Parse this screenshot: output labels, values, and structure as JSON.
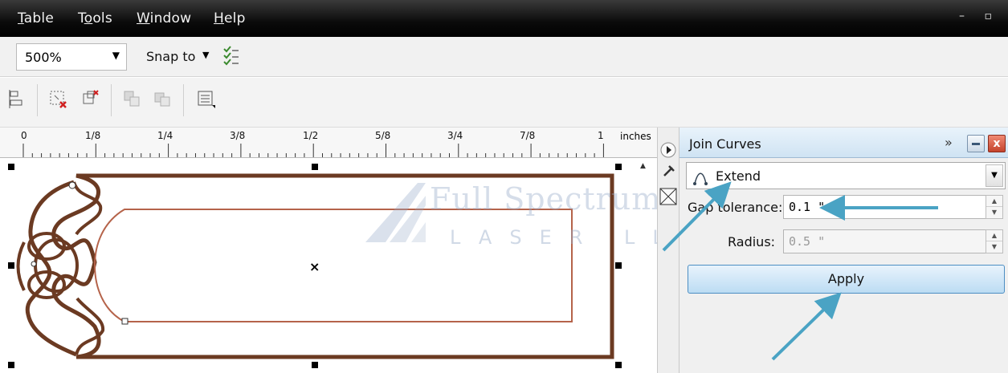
{
  "menu": {
    "items": [
      {
        "label": "Table",
        "underline_index": 0
      },
      {
        "label": "Tools",
        "underline_index": 1
      },
      {
        "label": "Window",
        "underline_index": 0
      },
      {
        "label": "Help",
        "underline_index": 0
      }
    ],
    "window_controls": "– ▫"
  },
  "property_bar": {
    "zoom_value": "500%",
    "snap_label": "Snap to",
    "snap_arrow": "▼"
  },
  "ruler": {
    "ticks": [
      "0",
      "1/8",
      "1/4",
      "3/8",
      "1/2",
      "5/8",
      "3/4",
      "7/8",
      "1"
    ],
    "units": "inches"
  },
  "canvas": {
    "center_mark": "×",
    "stroke_color_outer": "#6b3a22",
    "stroke_color_inner": "#b5634a",
    "watermark_line1": "Full Spectrum",
    "watermark_line2": "LASER LLC"
  },
  "docker": {
    "title": "Join Curves",
    "expand_glyph": "»",
    "close_glyph": "x",
    "mode_value": "Extend",
    "gap_tolerance_label": "Gap tolerance:",
    "gap_tolerance_value": "0.1 \"",
    "radius_label": "Radius:",
    "radius_value": "0.5 \"",
    "apply_label": "Apply"
  },
  "colors": {
    "annotation_arrow": "#4aa3c4",
    "accent_blue": "#4c8ec3"
  }
}
